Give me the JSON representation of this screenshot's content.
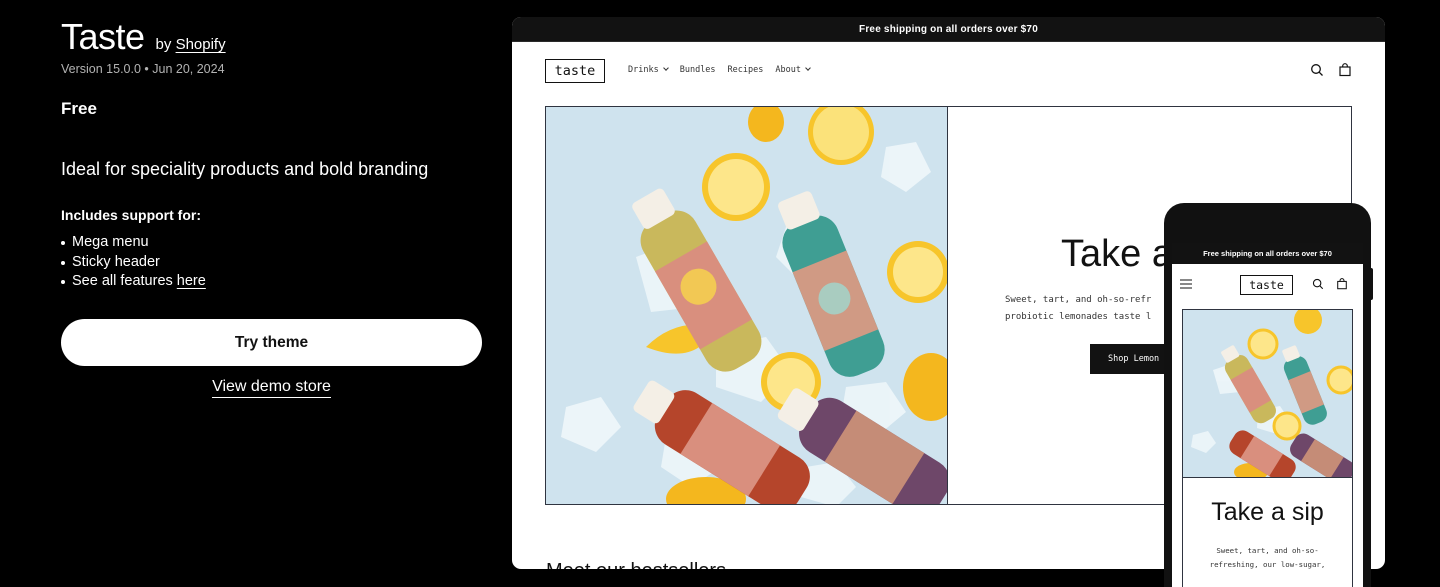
{
  "theme": {
    "name": "Taste",
    "by_prefix": "by",
    "by_link": "Shopify",
    "meta": "Version 15.0.0 • Jun 20, 2024",
    "price": "Free",
    "tagline": "Ideal for speciality products and bold branding",
    "includes_heading": "Includes support for:",
    "features": [
      "Mega menu",
      "Sticky header"
    ],
    "features_link_prefix": "See all features",
    "features_link": "here",
    "try_button": "Try theme",
    "demo_link": "View demo store"
  },
  "desktop_preview": {
    "announcement": "Free shipping on all orders over $70",
    "logo": "taste",
    "nav": [
      {
        "label": "Drinks",
        "dropdown": true
      },
      {
        "label": "Bundles",
        "dropdown": false
      },
      {
        "label": "Recipes",
        "dropdown": false
      },
      {
        "label": "About",
        "dropdown": true
      }
    ],
    "hero_title": "Take a",
    "hero_body_line1": "Sweet, tart, and oh-so-refr",
    "hero_body_line2": "probiotic lemonades taste l",
    "hero_button": "Shop Lemon",
    "section_title": "Meet our bestsellers"
  },
  "mobile_preview": {
    "announcement": "Free shipping on all orders over $70",
    "logo": "taste",
    "hero_title": "Take a sip",
    "hero_body_line1": "Sweet, tart, and oh-so-",
    "hero_body_line2": "refreshing, our low-sugar,"
  },
  "colors": {
    "page_bg": "#000000",
    "ink": "#121212",
    "hero_sky": "#cfe3ee",
    "lemon": "#f7c52b",
    "teal_bottle": "#3f9e93",
    "pink_bottle": "#d98f7e",
    "purple_bottle": "#6e4769"
  }
}
